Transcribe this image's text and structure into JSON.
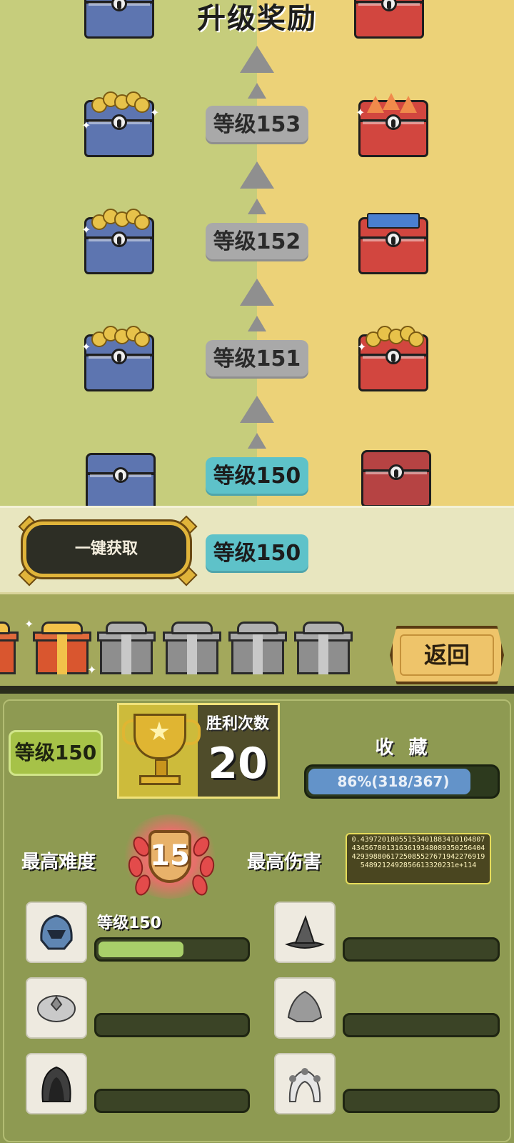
{
  "header": {
    "title": "升级奖励"
  },
  "track": {
    "levels": [
      {
        "label": "等级153",
        "state": "locked"
      },
      {
        "label": "等级152",
        "state": "locked"
      },
      {
        "label": "等级151",
        "state": "locked"
      },
      {
        "label": "等级150",
        "state": "current"
      }
    ],
    "left_rewards": [
      "gold-coins-chest",
      "gold-coins-chest",
      "gold-coins-chest",
      "blue-chest"
    ],
    "right_rewards": [
      "orange-gems-chest",
      "tickets-chest",
      "gold-coins-chest",
      "red-chest"
    ]
  },
  "claim_bar": {
    "claim_all_label": "一键获取",
    "current_level_label": "等级150"
  },
  "gifts": [
    {
      "icon": "gift-box-partial-icon",
      "state": "partial"
    },
    {
      "icon": "gift-box-gold-icon",
      "state": "unlocked"
    },
    {
      "icon": "gift-box-grey-icon",
      "state": "locked"
    },
    {
      "icon": "gift-box-grey-icon",
      "state": "locked"
    },
    {
      "icon": "gift-box-grey-icon",
      "state": "locked"
    },
    {
      "icon": "gift-box-grey-icon",
      "state": "locked"
    }
  ],
  "back_button": {
    "label": "返回"
  },
  "stats": {
    "level_label": "等级150",
    "wins_label": "胜利次数",
    "wins_value": "20",
    "collection_label": "收 藏",
    "collection_text": "86%(318/367)",
    "collection_fraction": 0.866,
    "highest_difficulty_label": "最高难度",
    "highest_difficulty_value": "15",
    "highest_damage_label": "最高伤害",
    "highest_damage_value": "0.43972018055153401883410104807434567801316361934808935025640442939880617250855276719422769195489212492856613320231e+114"
  },
  "equipment": [
    {
      "icon": "blue-helmet-icon",
      "level_label": "等级150",
      "progress": 0.58
    },
    {
      "icon": "witch-hat-icon",
      "level_label": "",
      "progress": 0
    },
    {
      "icon": "turban-icon",
      "level_label": "",
      "progress": 0
    },
    {
      "icon": "leaf-helmet-icon",
      "level_label": "",
      "progress": 0
    },
    {
      "icon": "dark-hood-icon",
      "level_label": "",
      "progress": 0
    },
    {
      "icon": "flower-veil-icon",
      "level_label": "",
      "progress": 0
    }
  ],
  "colors": {
    "track_left": "#c6cd7c",
    "track_right": "#ecd278",
    "current_level": "#5ec2c9",
    "locked_level": "#a9a9a9",
    "panel": "#8e9a52",
    "collection_fill": "#6393c9",
    "progress_fill": "#a8cf6a"
  }
}
